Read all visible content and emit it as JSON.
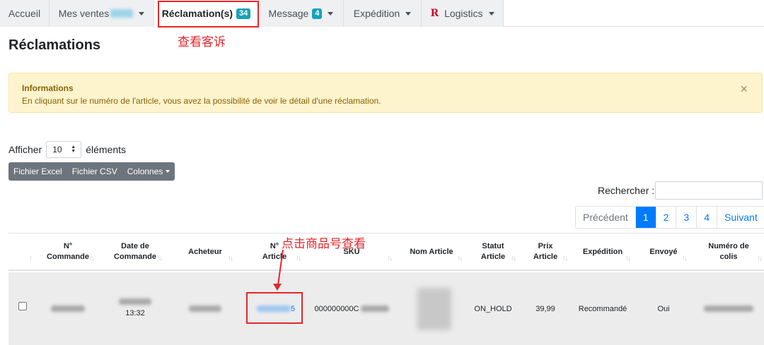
{
  "tabs": {
    "accueil": "Accueil",
    "ventes": "Mes ventes",
    "reclamations": "Réclamation(s)",
    "reclamations_count": "34",
    "message": "Message",
    "message_count": "4",
    "expedition": "Expédition",
    "logistics_logo": "R",
    "logistics": "Logistics"
  },
  "annotations": {
    "view_claims": "查看客诉",
    "click_item": "点击商品号查看"
  },
  "page_title": "Réclamations",
  "alert": {
    "title": "Informations",
    "text": "En cliquant sur le numéro de l'article, vous avez la possibilité de voir le détail d'une réclamation.",
    "close": "×"
  },
  "length": {
    "prefix": "Afficher",
    "value": "10",
    "suffix": "éléments"
  },
  "buttons": {
    "excel": "Fichier Excel",
    "csv": "Fichier CSV",
    "colonnes": "Colonnes"
  },
  "search": {
    "label": "Rechercher :",
    "value": ""
  },
  "pagination": {
    "prev": "Précédent",
    "pages": [
      "1",
      "2",
      "3",
      "4"
    ],
    "next": "Suivant"
  },
  "table": {
    "headers": {
      "commande": [
        "N°",
        "Commande"
      ],
      "date": [
        "Date de",
        "Commande"
      ],
      "acheteur": "Acheteur",
      "article": [
        "N°",
        "Article"
      ],
      "sku": "SKU",
      "nom": "Nom Article",
      "statut": [
        "Statut",
        "Article"
      ],
      "prix": [
        "Prix",
        "Article"
      ],
      "expedition": "Expédition",
      "envoye": "Envoyé",
      "colis": [
        "Numéro de",
        "colis"
      ]
    },
    "rows": [
      {
        "date_time": "13:32",
        "article_suffix": "5",
        "sku": "000000000C",
        "statut": "ON_HOLD",
        "prix": "39,99",
        "expedition": "Recommandé",
        "envoye": "Oui"
      }
    ]
  },
  "colors": {
    "primary": "#007bff",
    "badge": "#17a2b8",
    "alert_bg": "#fdf3cd",
    "annotation": "#e5262a"
  }
}
